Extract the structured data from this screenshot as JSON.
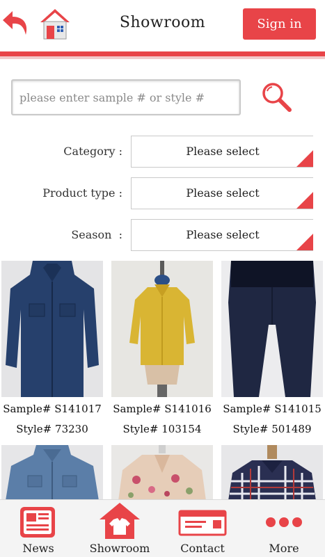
{
  "header": {
    "title": "Showroom",
    "sign_in_label": "Sign in",
    "accent_color": "#e84448"
  },
  "search": {
    "placeholder": "please enter sample # or style #",
    "value": ""
  },
  "filters": [
    {
      "label": "Category :",
      "value": "Please select"
    },
    {
      "label": "Product type :",
      "value": "Please select"
    },
    {
      "label": "Season  :",
      "value": "Please select"
    }
  ],
  "products": [
    {
      "sample": "Sample# S141017",
      "style": "Style# 73230",
      "image": "blue denim shirt"
    },
    {
      "sample": "Sample# S141016",
      "style": "Style# 103154",
      "image": "yellow shirt"
    },
    {
      "sample": "Sample# S141015",
      "style": "Style# 501489",
      "image": "navy pants"
    },
    {
      "sample": "",
      "style": "",
      "image": "light denim shirt"
    },
    {
      "sample": "",
      "style": "",
      "image": "floral blouse"
    },
    {
      "sample": "",
      "style": "",
      "image": "plaid shirt"
    }
  ],
  "bottom_nav": [
    {
      "label": "News",
      "icon": "newspaper-icon"
    },
    {
      "label": "Showroom",
      "icon": "shirt-house-icon"
    },
    {
      "label": "Contact",
      "icon": "envelope-icon"
    },
    {
      "label": "More",
      "icon": "more-dots-icon"
    }
  ]
}
